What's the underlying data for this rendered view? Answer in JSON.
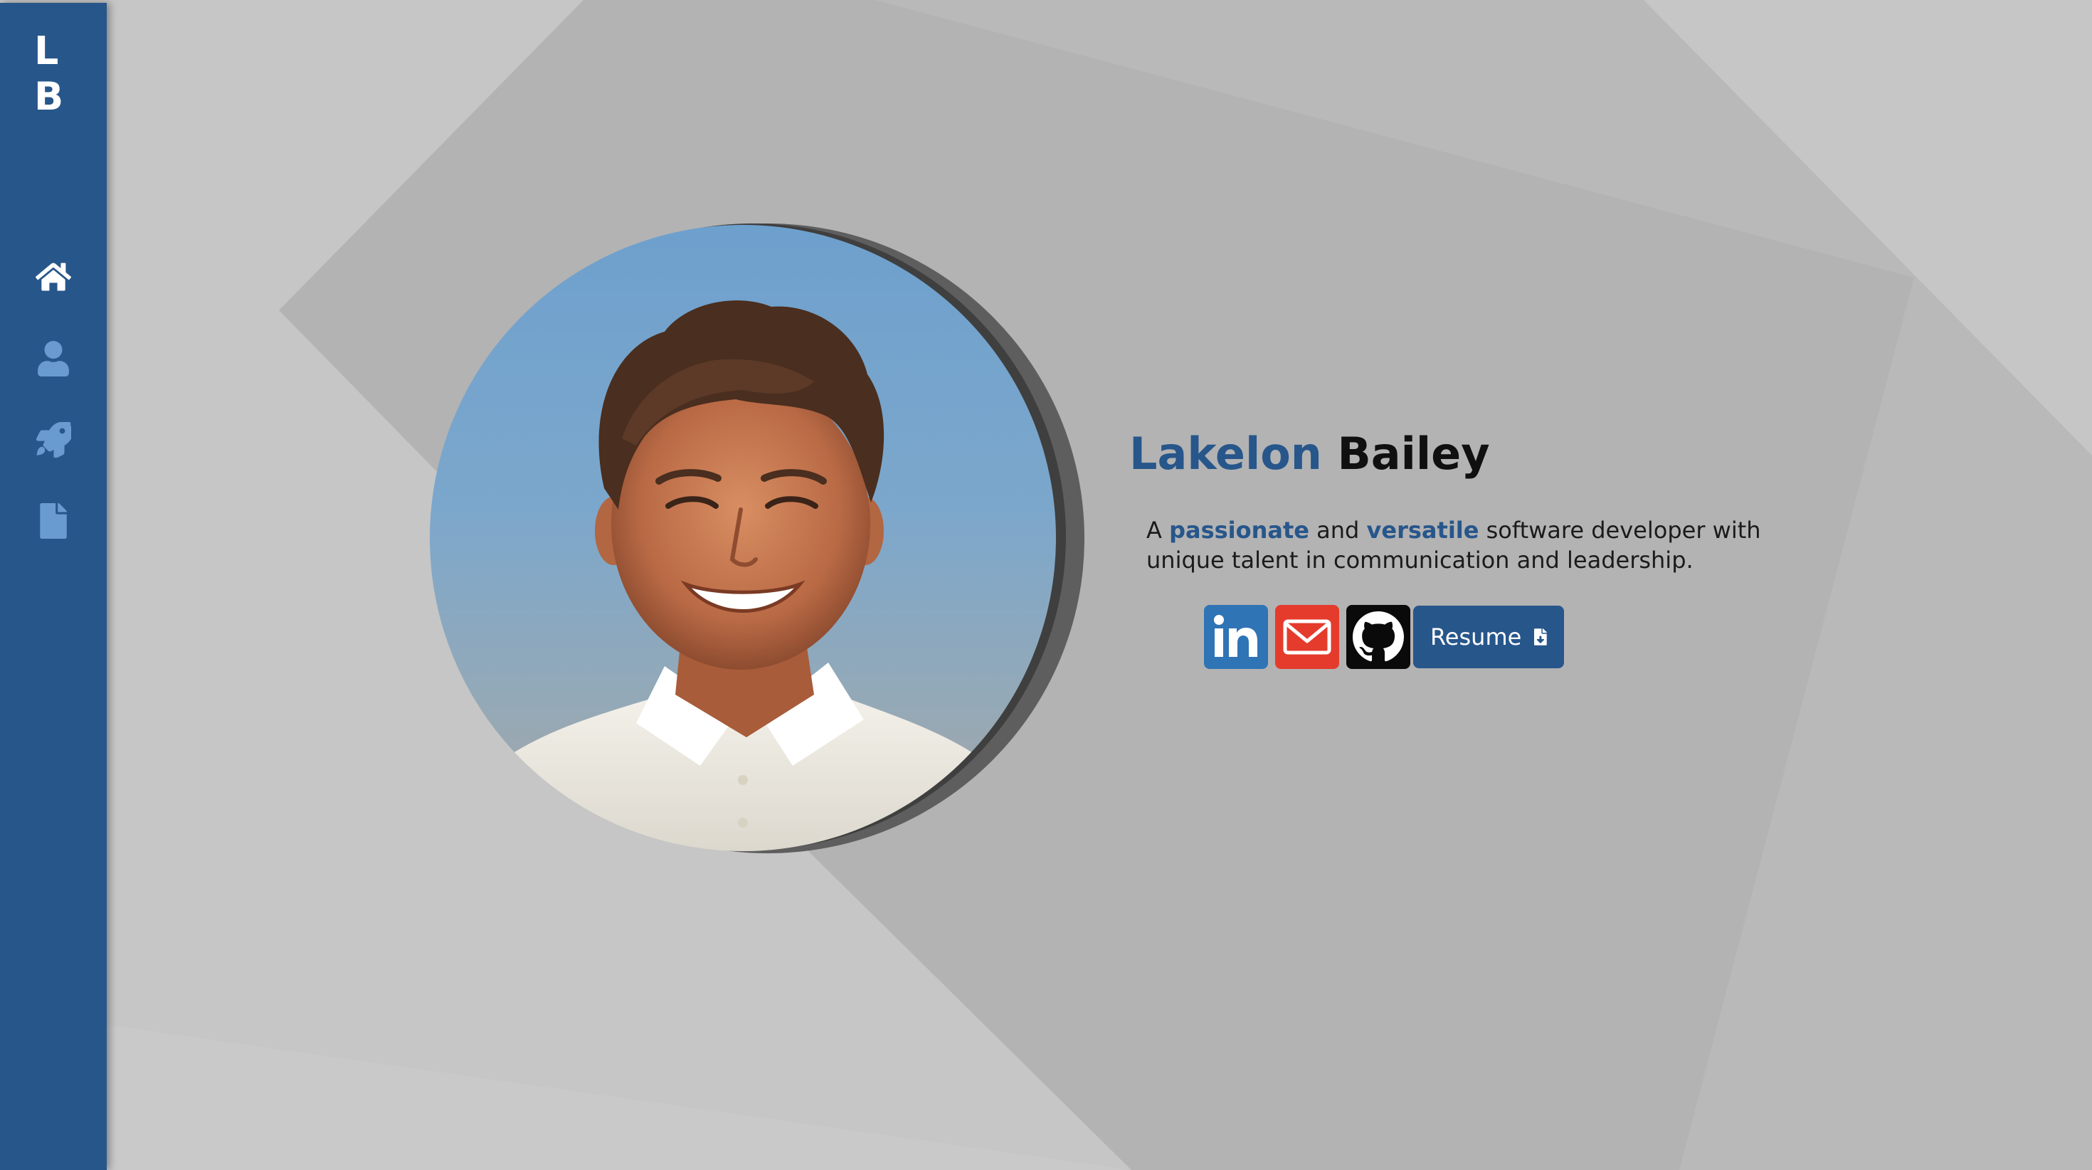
{
  "logo": {
    "line1": "L",
    "line2": "B"
  },
  "nav": [
    {
      "name": "home",
      "icon": "home-icon",
      "active": true
    },
    {
      "name": "about",
      "icon": "user-icon",
      "active": false
    },
    {
      "name": "projects",
      "icon": "rocket-icon",
      "active": false
    },
    {
      "name": "resume",
      "icon": "file-icon",
      "active": false
    }
  ],
  "intro": {
    "first_name": "Lakelon",
    "last_name": "Bailey",
    "tagline_parts": {
      "p1": "A ",
      "hl1": "passionate",
      "p2": " and ",
      "hl2": "versatile",
      "p3": " software developer with unique talent in communication and leadership."
    }
  },
  "socials": [
    {
      "name": "linkedin",
      "icon": "linkedin-icon"
    },
    {
      "name": "email",
      "icon": "envelope-icon"
    },
    {
      "name": "github",
      "icon": "github-icon"
    }
  ],
  "resume_button": {
    "label": "Resume",
    "icon": "file-download-icon"
  },
  "colors": {
    "primary": "#27568b",
    "linkedin": "#2f74b5",
    "email": "#e53b2c",
    "github": "#0a0a0a",
    "background": "#c6c6c6",
    "nav_inactive": "#6a9bd0"
  }
}
